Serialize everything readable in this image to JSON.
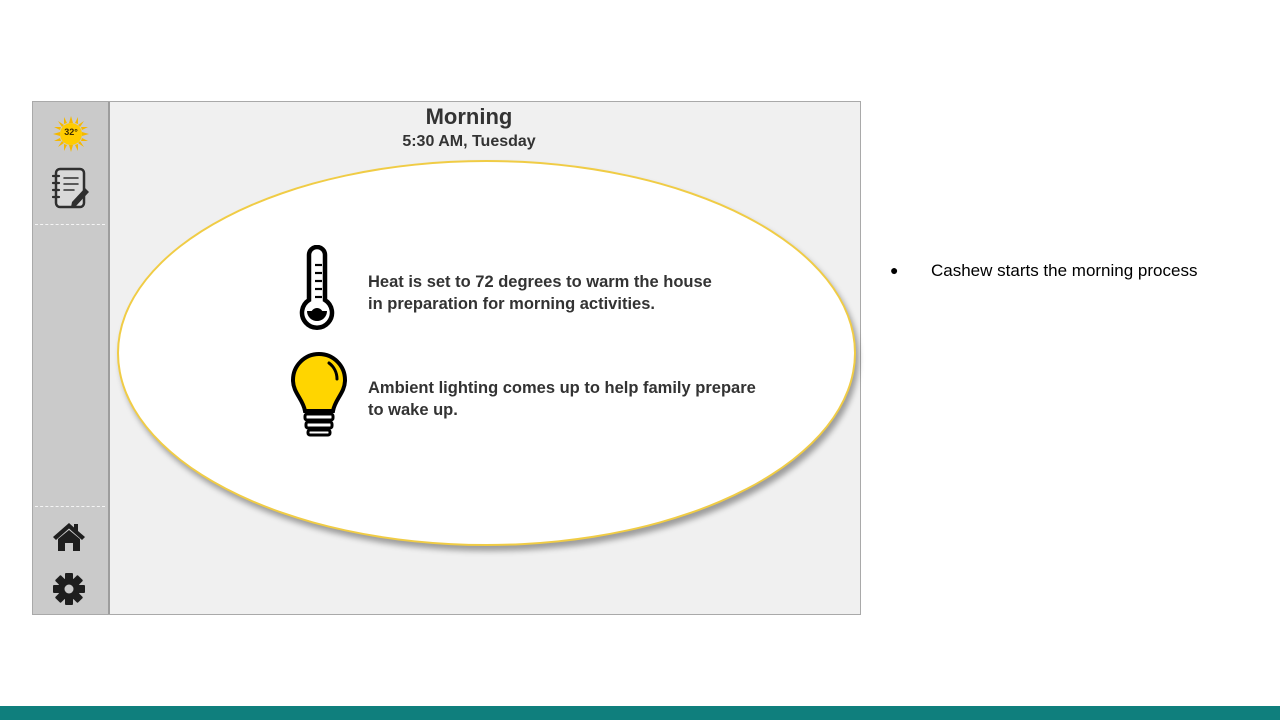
{
  "sidebar": {
    "weather_temp": "32°",
    "icons": [
      "sun-icon",
      "notebook-icon",
      "home-icon",
      "gear-icon"
    ]
  },
  "header": {
    "title": "Morning",
    "subtitle": "5:30 AM, Tuesday"
  },
  "messages": [
    {
      "icon": "thermometer-icon",
      "text": "Heat is set to 72 degrees to warm the house\nin preparation for morning activities."
    },
    {
      "icon": "lightbulb-icon",
      "text": "Ambient lighting comes up to help family prepare\nto wake up."
    }
  ],
  "notes": {
    "bullet": "●",
    "items": [
      "Cashew starts the morning process"
    ]
  },
  "colors": {
    "oval_border": "#f0cc45",
    "bulb_fill": "#ffd500",
    "footer_bar": "#0f7f7d",
    "sidebar_bg": "#cacaca"
  }
}
